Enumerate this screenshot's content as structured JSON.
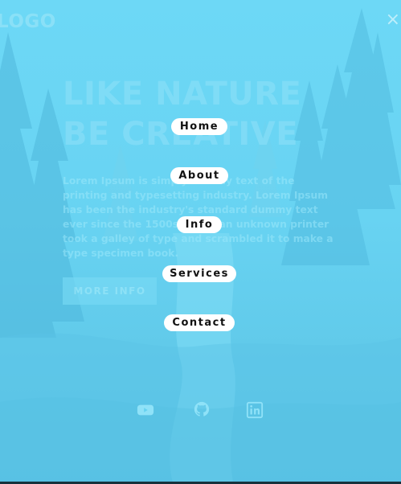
{
  "brand": {
    "logo_text": "LOGO"
  },
  "close_label": "×",
  "hero": {
    "title_line1": "LIKE NATURE",
    "title_line2": "BE CREATIVE",
    "body": "Lorem Ipsum is simply dummy text of the printing and typesetting industry. Lorem Ipsum has been the industry's standard dummy text ever since the 1500s, when an unknown printer took a galley of type and scrambled it to make a type specimen book.",
    "cta_label": "MORE INFO"
  },
  "menu": {
    "items": [
      {
        "label": "Home"
      },
      {
        "label": "About"
      },
      {
        "label": "Info"
      },
      {
        "label": "Services"
      },
      {
        "label": "Contact"
      }
    ]
  },
  "social": [
    {
      "icon": "youtube-icon"
    },
    {
      "icon": "github-icon"
    },
    {
      "icon": "linkedin-icon"
    }
  ],
  "colors": {
    "overlay": "#63cfee",
    "pill_bg": "#ffffff",
    "pill_text": "#111111"
  }
}
